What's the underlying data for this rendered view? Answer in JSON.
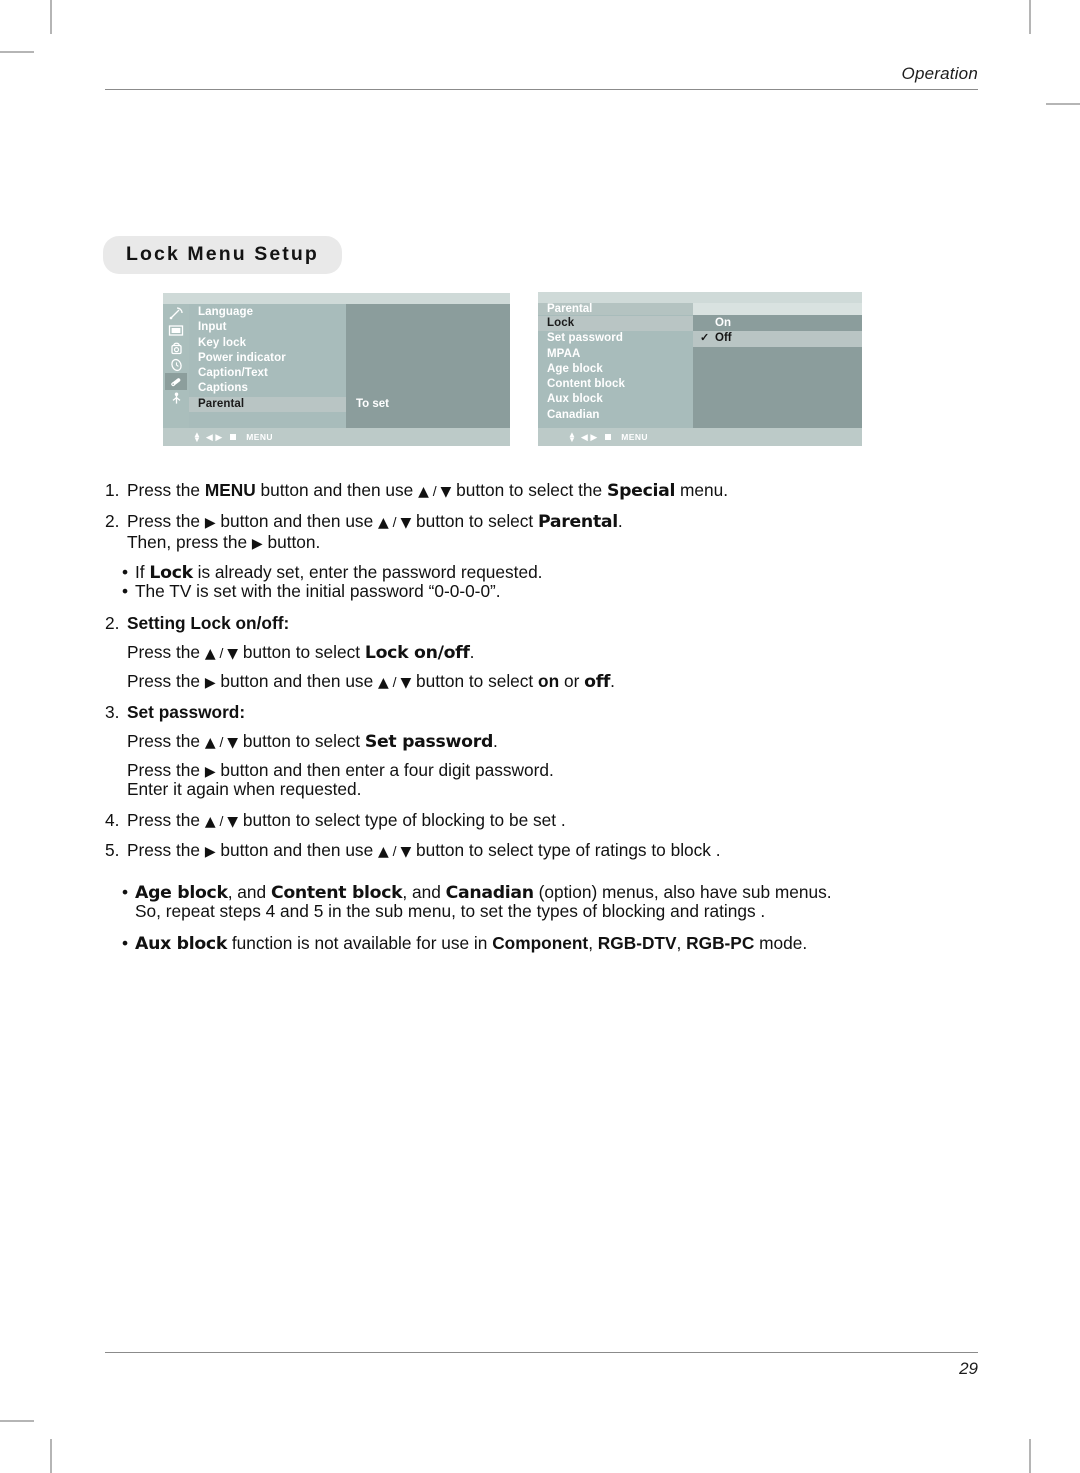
{
  "page": {
    "header_label": "Operation",
    "page_number": "29",
    "section_title": "Lock Menu Setup"
  },
  "osd_special": {
    "icons": [
      "antenna-icon",
      "picture-icon",
      "audio-icon",
      "timer-icon",
      "lock-icon",
      "setup-icon"
    ],
    "active_icon_index": 4,
    "menu_items": [
      {
        "label": "Language",
        "selected": false
      },
      {
        "label": "Input",
        "selected": false
      },
      {
        "label": "Key lock",
        "selected": false
      },
      {
        "label": "Power indicator",
        "selected": false
      },
      {
        "label": "Caption/Text",
        "selected": false
      },
      {
        "label": "Captions",
        "selected": false
      },
      {
        "label": "Parental",
        "selected": true
      }
    ],
    "value_label": "To set",
    "nav_label": "MENU"
  },
  "osd_parental": {
    "title": "Parental",
    "menu_items": [
      {
        "label": "Lock",
        "selected": true
      },
      {
        "label": "Set password",
        "selected": false
      },
      {
        "label": "MPAA",
        "selected": false
      },
      {
        "label": "Age block",
        "selected": false
      },
      {
        "label": "Content block",
        "selected": false
      },
      {
        "label": "Aux block",
        "selected": false
      },
      {
        "label": "Canadian",
        "selected": false
      }
    ],
    "options": [
      {
        "label": "On",
        "selected": false,
        "check": ""
      },
      {
        "label": "Off",
        "selected": true,
        "check": "✓"
      }
    ],
    "nav_label": "MENU"
  },
  "instructions": {
    "step1": {
      "num": "1.",
      "t1": "Press the ",
      "menu": "MENU",
      "t2": " button and then use ",
      "up": "▲",
      "slash": " / ",
      "down": "▼",
      "t3": " button to select the ",
      "special": "Special",
      "t4": " menu."
    },
    "step2": {
      "num": "2.",
      "t1": "Press the ",
      "right": "▶",
      "t2": " button and then use ",
      "up": "▲",
      "slash": " / ",
      "down": "▼",
      "t3": " button to select ",
      "parental": "Parental",
      "t4": ".",
      "line2a": "Then, press the ",
      "line2b": " button."
    },
    "bullets_a": [
      {
        "t1": "If ",
        "bold": "Lock",
        "t2": " is already set, enter the password requested."
      },
      {
        "t1": "The TV is set with the initial password “0-0-0-0”.",
        "bold": "",
        "t2": ""
      }
    ],
    "step_lock": {
      "num": "2.",
      "heading": "Setting Lock on/off:",
      "line1a": "Press the ",
      "up": "▲",
      "slash": " / ",
      "down": "▼",
      "line1b": " button to select ",
      "line1bold": "Lock on/off",
      "line1c": ".",
      "line2a": "Press the ",
      "right": "▶",
      "line2b": " button and then use ",
      "line2c": " button to select ",
      "on": "on",
      "orr": " or ",
      "off": "off",
      "line2d": "."
    },
    "step_password": {
      "num": "3.",
      "heading": "Set password:",
      "line1a": "Press the ",
      "up": "▲",
      "slash": " / ",
      "down": "▼",
      "line1b": " button to select ",
      "line1bold": "Set password",
      "line1c": ".",
      "line2a": "Press the ",
      "right": "▶",
      "line2b": " button and then enter a four digit password.",
      "line3": "Enter it again when requested."
    },
    "step4": {
      "num": "4.",
      "t1": "Press the ",
      "up": "▲",
      "slash": " / ",
      "down": "▼",
      "t2": " button to select type of blocking to be set ."
    },
    "step5": {
      "num": "5.",
      "t1": "Press the ",
      "right": "▶",
      "t2": " button and then use ",
      "up": "▲",
      "slash": " / ",
      "down": "▼",
      "t3": " button to select type of ratings to block ."
    },
    "notes": {
      "note1_age": "Age block",
      "note1_a": ", and ",
      "note1_content": "Content block",
      "note1_b": ", and ",
      "note1_canadian": "Canadian",
      "note1_c": " (option) menus, also have sub menus.",
      "note1_line2": "So, repeat steps 4 and 5 in the sub menu, to set the types of blocking and ratings .",
      "note2_aux": "Aux block",
      "note2_a": " function is not available for use in ",
      "note2_component": "Component",
      "note2_b": ", ",
      "note2_rgbdtv": "RGB-DTV",
      "note2_c": ", ",
      "note2_rgbpc": "RGB-PC",
      "note2_d": " mode."
    }
  },
  "colors": {
    "osd_frame": "#d9e2e0",
    "osd_menu_bg": "#a8bcbb",
    "osd_value_bg": "#8b9d9c",
    "osd_selected": "#b9c5c4",
    "osd_nav": "#bccac8",
    "pill_bg": "#e9e9e9",
    "text": "#111111"
  }
}
